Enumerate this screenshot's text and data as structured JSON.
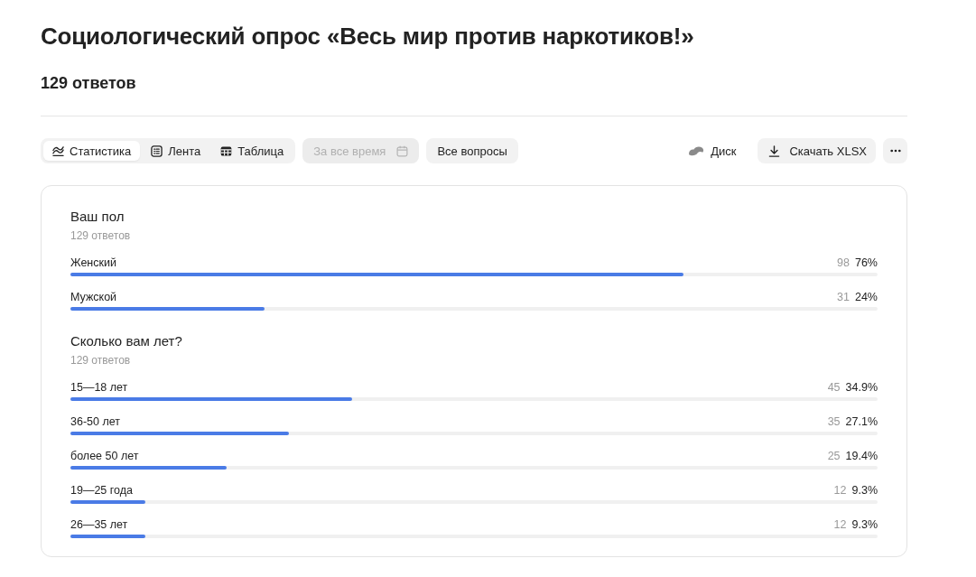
{
  "title": "Социологический опрос «Весь мир против наркотиков!»",
  "response_count": "129 ответов",
  "toolbar": {
    "view_tabs": [
      {
        "label": "Статистика",
        "selected": true
      },
      {
        "label": "Лента",
        "selected": false
      },
      {
        "label": "Таблица",
        "selected": false
      }
    ],
    "date_filter": {
      "label": "За все время",
      "disabled": true
    },
    "question_filter": {
      "label": "Все вопросы"
    },
    "disk_button": {
      "label": "Диск"
    },
    "download_button": {
      "label": "Скачать XLSX"
    }
  },
  "questions": [
    {
      "title": "Ваш пол",
      "count": "129 ответов",
      "answers": [
        {
          "label": "Женский",
          "count": "98",
          "percent": "76%",
          "level": 0.76
        },
        {
          "label": "Мужской",
          "count": "31",
          "percent": "24%",
          "level": 0.24
        }
      ]
    },
    {
      "title": "Сколько вам лет?",
      "count": "129 ответов",
      "answers": [
        {
          "label": "15—18 лет",
          "count": "45",
          "percent": "34.9%",
          "level": 0.349
        },
        {
          "label": "36-50 лет",
          "count": "35",
          "percent": "27.1%",
          "level": 0.271
        },
        {
          "label": "более 50 лет",
          "count": "25",
          "percent": "19.4%",
          "level": 0.194
        },
        {
          "label": "19—25 года",
          "count": "12",
          "percent": "9.3%",
          "level": 0.093
        },
        {
          "label": "26—35 лет",
          "count": "12",
          "percent": "9.3%",
          "level": 0.093
        }
      ]
    }
  ]
}
